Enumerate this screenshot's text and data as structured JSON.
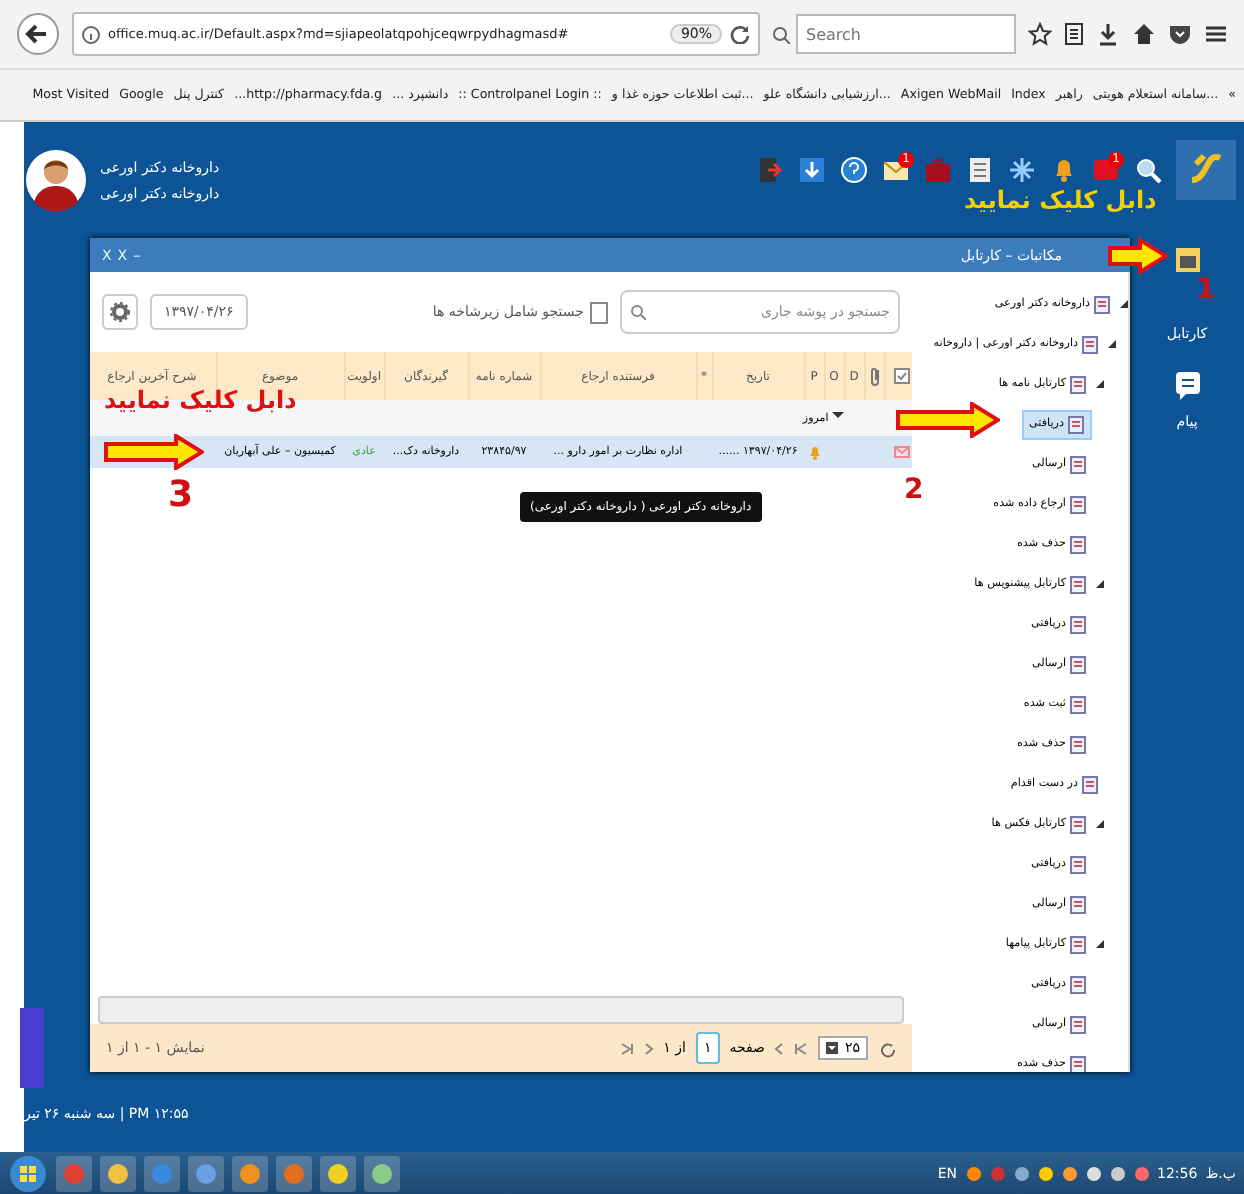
{
  "browser": {
    "url": "office.muq.ac.ir/Default.aspx?md=sjiapeolatqpohjceqwrpydhagmasd#",
    "zoom": "90%",
    "search_placeholder": "Search",
    "bookmarks_more": "»",
    "bookmarks": [
      "...سامانه استعلام هویتی",
      "راهبر",
      "Index",
      "Axigen WebMail",
      "...ارزشیابی دانشگاه علو",
      "...ثبت اطلاعات حوزه غذا و",
      ":: Controlpanel Login ::",
      "دانشپرد ...",
      "http://pharmacy.fda.g...",
      "کنترل پنل",
      "Google",
      "Most Visited"
    ]
  },
  "header": {
    "user_lines": [
      "داروخانه دکتر اورعی",
      "داروخانه دکتر اورعی"
    ],
    "badges": [
      "1",
      "1"
    ]
  },
  "annotations": [
    {
      "text": "دابل کلیک نمایید",
      "number": "1"
    },
    {
      "number": "2"
    },
    {
      "text": "دابل کلیک نمایید",
      "number": "3"
    }
  ],
  "sidebar": {
    "items": [
      {
        "label": "کارتابل"
      },
      {
        "label": "پیام"
      }
    ]
  },
  "panel": {
    "title": "مکاتبات – کارتابل",
    "window_buttons": [
      "–",
      "X",
      "X"
    ],
    "date": "۱۳۹۷/۰۴/۲۶",
    "search": {
      "placeholder": "جستجو در پوشه جاری"
    },
    "subfolders": {
      "label": "جستجو شامل زیرشاخه ها",
      "checked": false
    },
    "table": {
      "columns": [
        {
          "kind": "checkbox"
        },
        {
          "kind": "attachment"
        },
        {
          "kind": "text",
          "label": "D"
        },
        {
          "kind": "text",
          "label": "O"
        },
        {
          "kind": "text",
          "label": "P"
        },
        {
          "kind": "text",
          "label": "تاریخ"
        },
        {
          "kind": "text",
          "label": "*"
        },
        {
          "kind": "text",
          "label": "فرستنده ارجاع"
        },
        {
          "kind": "text",
          "label": "شماره نامه"
        },
        {
          "kind": "text",
          "label": "گیرندگان"
        },
        {
          "kind": "text",
          "label": "اولویت"
        },
        {
          "kind": "text",
          "label": "موضوع"
        },
        {
          "kind": "text",
          "label": "شرح آخرین ارجاع"
        }
      ],
      "group": {
        "label": "امروز",
        "expanded": true
      },
      "rows": [
        {
          "selected": true,
          "cells": [
            "",
            "",
            "",
            "",
            "",
            "۱۳۹۷/۰۴/۲۶ ......",
            "",
            "اداره نظارت بر امور دارو ...",
            "۲۳۸۴۵/۹۷",
            "داروخانه دک...",
            "عادی",
            "کمیسیون – علی آبهاریان",
            ""
          ]
        }
      ],
      "tooltip": "داروخانه دکتر اورعی ( داروخانه دکتر اورعی)"
    },
    "pager": {
      "page_size": "۲۵",
      "page_label": "صفحه",
      "page": "۱",
      "of": "از ۱",
      "summary": "نمایش ۱ - ۱ از ۱"
    },
    "tree": [
      {
        "label": "داروخانه دکتر اورعی",
        "expanded": true,
        "selected": false,
        "children": [
          {
            "label": "داروخانه دکتر اورعی | داروخانه",
            "expanded": true,
            "selected": false,
            "children": [
              {
                "label": "کارتابل نامه ها",
                "expanded": true,
                "selected": false,
                "children": [
                  {
                    "label": "دریافتی",
                    "selected": true
                  },
                  {
                    "label": "ارسالی",
                    "selected": false
                  },
                  {
                    "label": "ارجاع داده شده",
                    "selected": false
                  },
                  {
                    "label": "حذف شده",
                    "selected": false
                  }
                ]
              },
              {
                "label": "کارتابل پیشنویس ها",
                "expanded": true,
                "selected": false,
                "children": [
                  {
                    "label": "دریافتی",
                    "selected": false
                  },
                  {
                    "label": "ارسالی",
                    "selected": false
                  },
                  {
                    "label": "ثبت شده",
                    "selected": false
                  },
                  {
                    "label": "حذف شده",
                    "selected": false
                  }
                ]
              },
              {
                "label": "در دست اقدام",
                "selected": false
              },
              {
                "label": "کارتابل فکس ها",
                "expanded": true,
                "selected": false,
                "children": [
                  {
                    "label": "دریافتی",
                    "selected": false
                  },
                  {
                    "label": "ارسالی",
                    "selected": false
                  }
                ]
              },
              {
                "label": "کارتابل پیامها",
                "expanded": true,
                "selected": false,
                "children": [
                  {
                    "label": "دریافتی",
                    "selected": false
                  },
                  {
                    "label": "ارسالی",
                    "selected": false
                  },
                  {
                    "label": "حذف شده",
                    "selected": false
                  }
                ]
              }
            ]
          }
        ]
      }
    ]
  },
  "status": "PM ۱۲:۵۵ | سه شنبه ۲۶ تیر",
  "taskbar": {
    "language": "EN",
    "time": "12:56",
    "period": "ب.ظ"
  }
}
